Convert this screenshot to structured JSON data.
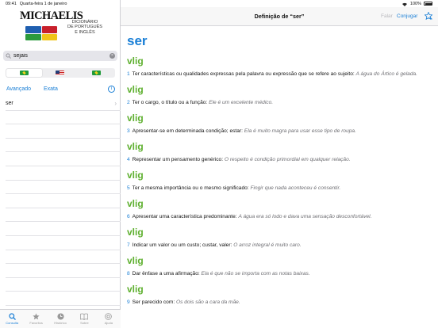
{
  "status_bar": {
    "time": "09:41",
    "date": "Quarta-feira 1 de janeiro",
    "battery": "100%"
  },
  "logo": {
    "word": "MICHAELIS",
    "subtitle": [
      "DICIONÁRIO",
      "DE PORTUGUÊS",
      "E INGLÊS"
    ]
  },
  "search": {
    "value": "sejais",
    "placeholder": ""
  },
  "language_options": [
    "pt-en",
    "en-pt",
    "pt-pt"
  ],
  "links": {
    "advanced": "Avançado",
    "exact": "Exata"
  },
  "results": [
    "ser"
  ],
  "tabs": [
    {
      "label": "Consulta",
      "icon": "search-icon",
      "active": true
    },
    {
      "label": "Favoritos",
      "icon": "star-icon",
      "active": false
    },
    {
      "label": "Histórico",
      "icon": "clock-icon",
      "active": false
    },
    {
      "label": "Sobre",
      "icon": "book-icon",
      "active": false
    },
    {
      "label": "Ajuda",
      "icon": "help-icon",
      "active": false
    }
  ],
  "nav": {
    "title": "Definição de “ser”",
    "speak": "Falar",
    "conjugate": "Conjugar"
  },
  "entry": {
    "word": "ser",
    "definitions": [
      {
        "pos": "vlig",
        "num": "1",
        "text": "Ter características ou qualidades expressas pela palavra ou expressão que se refere ao sujeito:",
        "example": "A água do Ártico é gelada."
      },
      {
        "pos": "vlig",
        "num": "2",
        "text": "Ter o cargo, o título ou a função:",
        "example": "Ele é um excelente médico."
      },
      {
        "pos": "vlig",
        "num": "3",
        "text": "Apresentar-se em determinada condição; estar:",
        "example": "Ela é muito magra para usar esse tipo de roupa."
      },
      {
        "pos": "vlig",
        "num": "4",
        "text": "Representar um pensamento genérico:",
        "example": "O respeito é condição primordial em qualquer relação."
      },
      {
        "pos": "vlig",
        "num": "5",
        "text": "Ter a mesma importância ou o mesmo significado:",
        "example": "Fingir que nada aconteceu é consentir."
      },
      {
        "pos": "vlig",
        "num": "6",
        "text": "Apresentar uma característica predominante:",
        "example": "A água era só lodo e dava uma sensação desconfortável."
      },
      {
        "pos": "vlig",
        "num": "7",
        "text": "Indicar um valor ou um custo; custar, valer:",
        "example": "O arroz integral é muito caro."
      },
      {
        "pos": "vlig",
        "num": "8",
        "text": "Dar ênfase a uma afirmação:",
        "example": "Ela é que não se importa com as notas baixas."
      },
      {
        "pos": "vlig",
        "num": "9",
        "text": "Ser parecido com:",
        "example": "Os dois são a cara da mãe."
      }
    ]
  },
  "colors": {
    "accent": "#1a7fd6",
    "pos_green": "#5fb030",
    "example_gray": "#6d6d72"
  }
}
